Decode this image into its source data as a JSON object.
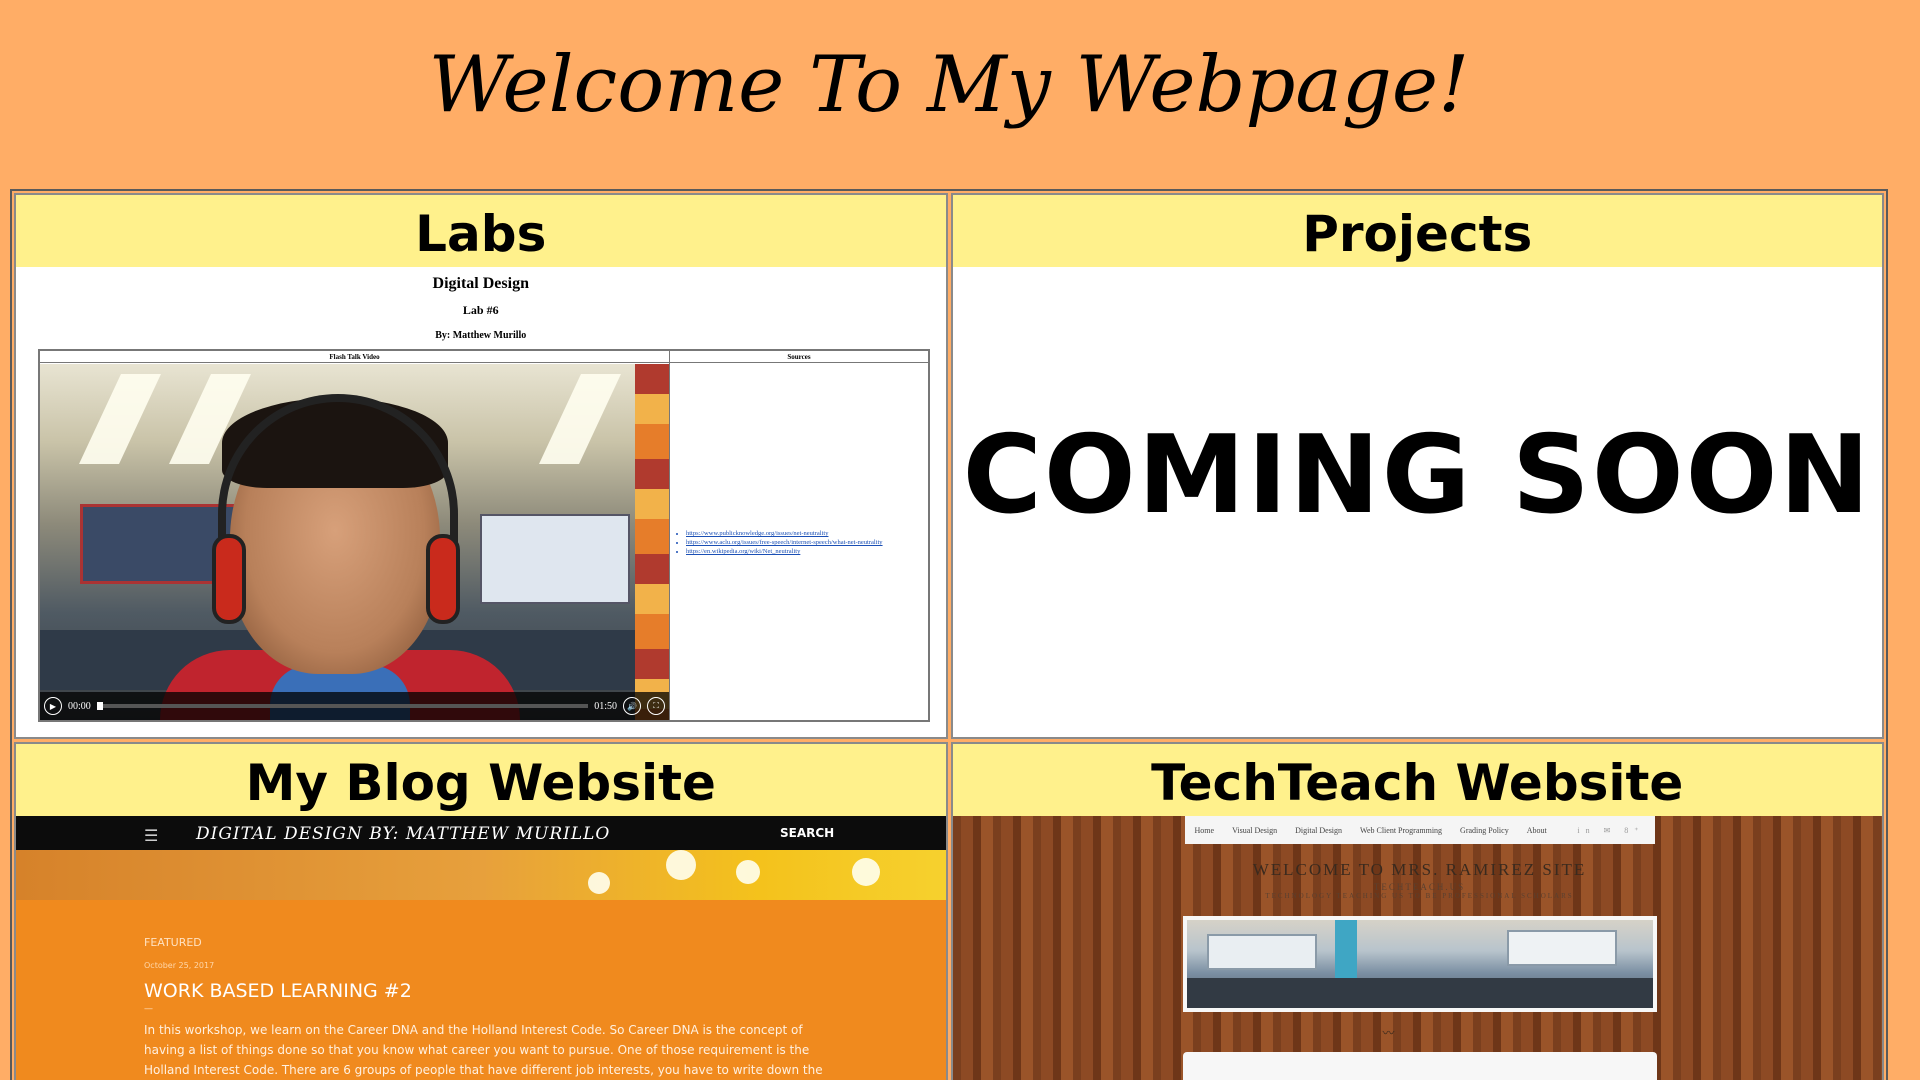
{
  "page": {
    "title": "Welcome To My Webpage!"
  },
  "labs": {
    "heading": "Labs",
    "doc_title": "Digital Design",
    "doc_lab": "Lab #6",
    "doc_author": "By: Matthew Murillo",
    "col_video": "Flash Talk Video",
    "col_sources": "Sources",
    "video": {
      "time_current": "00:00",
      "time_total": "01:50",
      "progress": 0.0
    },
    "sources": [
      "https://www.publicknowledge.org/issues/net-neutrality",
      "https://www.aclu.org/issues/free-speech/internet-speech/what-net-neutrality",
      "https://en.wikipedia.org/wiki/Net_neutrality"
    ]
  },
  "projects": {
    "heading": "Projects",
    "coming_soon": "COMING SOON"
  },
  "blog": {
    "heading": "My Blog Website",
    "site_title": "DIGITAL DESIGN BY: MATTHEW MURILLO",
    "search": "SEARCH",
    "featured": "FEATURED",
    "post_date": "October 25, 2017",
    "post_title": "WORK BASED LEARNING #2",
    "post_sep": "—",
    "post_body": "In this workshop, we learn on the Career DNA and the Holland Interest Code. So Career DNA is the concept of having a list of things done so that you know what career you want to pursue. One of those requirement is the Holland Interest Code. There are 6 groups of people that have different job interests, you have to write down the first three groups that you would join"
  },
  "techteach": {
    "heading": "TechTeach Website",
    "nav": [
      "Home",
      "Visual Design",
      "Digital Design",
      "Web Client Programming",
      "Grading Policy",
      "About"
    ],
    "social": "in ✉ 8⁺",
    "title": "WELCOME TO MRS. RAMIREZ SITE",
    "subtitle1": "TECHTEACH.US",
    "subtitle2": "TECHNOLOGY TEACHING US TO BE PROFESSIONAL SCHOLARS"
  }
}
